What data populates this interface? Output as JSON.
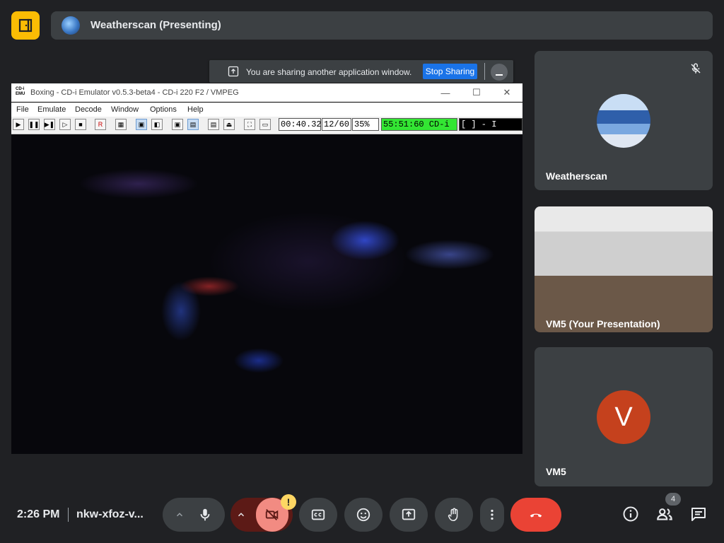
{
  "header": {
    "presenter_title": "Weatherscan (Presenting)"
  },
  "share_banner": {
    "message": "You are sharing another application window.",
    "stop_label": "Stop Sharing",
    "minimize_label": "–"
  },
  "emulator": {
    "logo_text": "CD-i EMU",
    "title": "Boxing - CD-i Emulator v0.5.3-beta4 - CD-i 220 F2 / VMPEG",
    "window_buttons": {
      "minimize": "—",
      "maximize": "☐",
      "close": "✕"
    },
    "menu": [
      "File",
      "Emulate",
      "Decode",
      "Window",
      "Options",
      "Help"
    ],
    "toolbar": {
      "time": "00:40.32",
      "frames": "12/60",
      "speed": "35%",
      "status": "55:51:60 CD-i",
      "extra": "[ ] - I",
      "record_label": "R"
    }
  },
  "tiles": [
    {
      "name": "Weatherscan",
      "muted": true
    },
    {
      "name": "VM5 (Your Presentation)"
    },
    {
      "name": "VM5",
      "initial": "V",
      "avatar_color": "#c5411d"
    }
  ],
  "bottom_bar": {
    "time": "2:26 PM",
    "meeting_code": "nkw-xfoz-v...",
    "warning_badge": "!",
    "participant_count": "4"
  },
  "colors": {
    "background": "#202124",
    "tile": "#3c4043",
    "danger": "#ea4335",
    "stop_share_blue": "#1a73e8",
    "logo_yellow": "#fbbc04",
    "camera_off": "#f28b82"
  }
}
